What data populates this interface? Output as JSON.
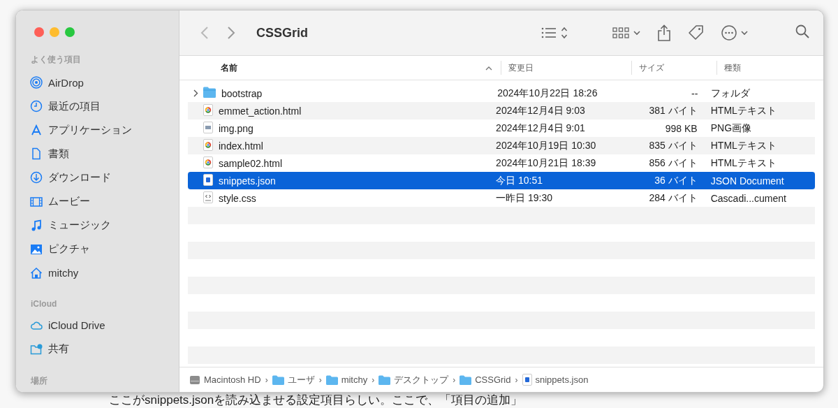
{
  "window": {
    "title": "CSSGrid"
  },
  "sidebar": {
    "sections": [
      {
        "heading": "よく使う項目",
        "items": [
          {
            "label": "AirDrop",
            "kind": "airdrop"
          },
          {
            "label": "最近の項目",
            "kind": "clock"
          },
          {
            "label": "アプリケーション",
            "kind": "apps"
          },
          {
            "label": "書類",
            "kind": "document"
          },
          {
            "label": "ダウンロード",
            "kind": "download"
          },
          {
            "label": "ムービー",
            "kind": "movie"
          },
          {
            "label": "ミュージック",
            "kind": "music"
          },
          {
            "label": "ピクチャ",
            "kind": "picture"
          },
          {
            "label": "mitchy",
            "kind": "home"
          }
        ]
      },
      {
        "heading": "iCloud",
        "items": [
          {
            "label": "iCloud Drive",
            "kind": "cloud"
          },
          {
            "label": "共有",
            "kind": "shared"
          }
        ]
      },
      {
        "heading": "場所"
      }
    ]
  },
  "table": {
    "columns": [
      {
        "label": "名前",
        "sorted": true
      },
      {
        "label": "変更日",
        "sorted": false
      },
      {
        "label": "サイズ",
        "sorted": false
      },
      {
        "label": "種類",
        "sorted": false
      }
    ],
    "rows": [
      {
        "name": "bootstrap",
        "modified": "2024年10月22日 18:26",
        "size": "--",
        "type": "フォルダ",
        "kind": "folder",
        "selected": false
      },
      {
        "name": "emmet_action.html",
        "modified": "2024年12月4日 9:03",
        "size": "381 バイト",
        "type": "HTMLテキスト",
        "kind": "html",
        "selected": false
      },
      {
        "name": "img.png",
        "modified": "2024年12月4日 9:01",
        "size": "998 KB",
        "type": "PNG画像",
        "kind": "image",
        "selected": false
      },
      {
        "name": "index.html",
        "modified": "2024年10月19日 10:30",
        "size": "835 バイト",
        "type": "HTMLテキスト",
        "kind": "html",
        "selected": false
      },
      {
        "name": "sample02.html",
        "modified": "2024年10月21日 18:39",
        "size": "856 バイト",
        "type": "HTMLテキスト",
        "kind": "html",
        "selected": false
      },
      {
        "name": "snippets.json",
        "modified": "今日 10:51",
        "size": "36 バイト",
        "type": "JSON Document",
        "kind": "json",
        "selected": true
      },
      {
        "name": "style.css",
        "modified": "一昨日 19:30",
        "size": "284 バイト",
        "type": "Cascadi...cument",
        "kind": "css",
        "selected": false
      }
    ]
  },
  "path_bar": [
    {
      "label": "Macintosh HD",
      "kind": "disk"
    },
    {
      "separator": "›",
      "label": "ユーザ",
      "kind": "folder"
    },
    {
      "separator": "›",
      "label": "mitchy",
      "kind": "folder"
    },
    {
      "separator": "›",
      "label": "デスクトップ",
      "kind": "folder"
    },
    {
      "separator": "›",
      "label": "CSSGrid",
      "kind": "folder"
    },
    {
      "separator": "›",
      "label": "snippets.json",
      "kind": "json"
    }
  ],
  "caption": "ここがsnippets.jsonを読み込ませる設定項目らしい。ここで、「項目の追加」"
}
